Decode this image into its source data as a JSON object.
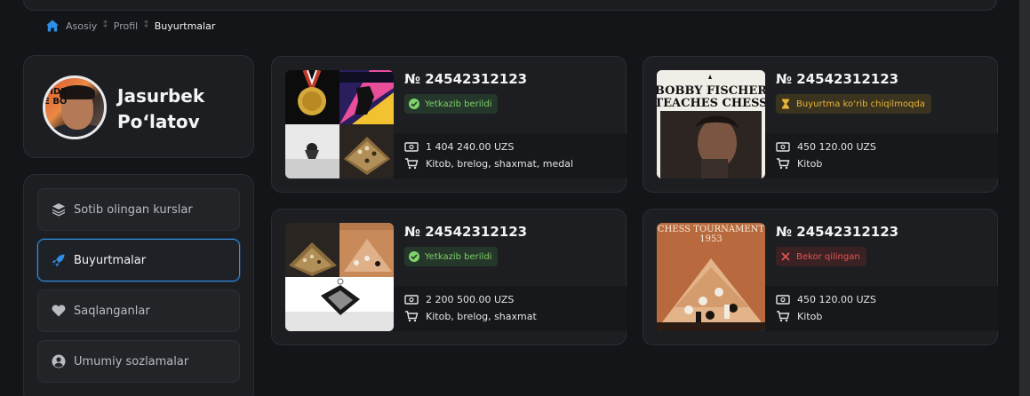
{
  "breadcrumb": {
    "items": [
      "Asosiy",
      "Profil",
      "Buyurtmalar"
    ]
  },
  "profile": {
    "first_name": "Jasurbek",
    "last_name": "Po‘latov",
    "avatar_sign": "SIDE\nE BO"
  },
  "menu": {
    "items": [
      {
        "label": "Sotib olingan kurslar",
        "icon": "layers-icon"
      },
      {
        "label": "Buyurtmalar",
        "icon": "rocket-icon",
        "active": true
      },
      {
        "label": "Saqlanganlar",
        "icon": "heart-icon"
      },
      {
        "label": "Umumiy sozlamalar",
        "icon": "user-circle-icon"
      }
    ]
  },
  "orders": [
    {
      "number": "№ 24542312123",
      "status": "Yetkazib berildi",
      "status_type": "delivered",
      "price": "1 404 240.00 UZS",
      "items": "Kitob, brelog, shaxmat, medal"
    },
    {
      "number": "№ 24542312123",
      "status": "Buyurtma ko‘rib chiqilmoqda",
      "status_type": "review",
      "price": "450 120.00 UZS",
      "items": "Kitob",
      "cover_title": "BOBBY FISCHER TEACHES CHESS"
    },
    {
      "number": "№ 24542312123",
      "status": "Yetkazib berildi",
      "status_type": "delivered",
      "price": "2 200 500.00 UZS",
      "items": "Kitob, brelog, shaxmat"
    },
    {
      "number": "№ 24542312123",
      "status": "Bekor qilingan",
      "status_type": "cancel",
      "price": "450 120.00 UZS",
      "items": "Kitob",
      "cover_title": "CHESS TOURNAMENT",
      "cover_year": "1953"
    }
  ],
  "colors": {
    "background": "#141518",
    "card": "#1c1e22",
    "accent": "#2f8fe6",
    "delivered": "#7fd36a",
    "review": "#e8b43a",
    "cancel": "#e85252"
  }
}
